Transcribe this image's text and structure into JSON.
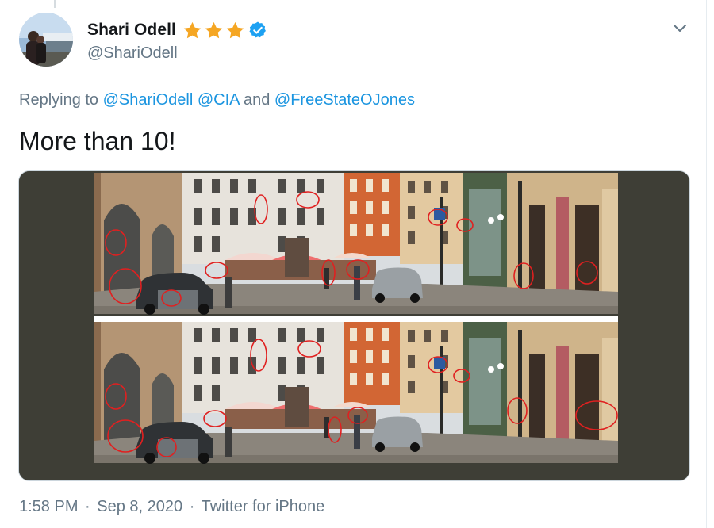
{
  "tweet": {
    "author": {
      "display_name": "Shari Odell",
      "handle": "@ShariOdell",
      "badges": [
        "star-icon",
        "star-icon",
        "star-icon",
        "verified-badge-icon"
      ]
    },
    "reply": {
      "prefix": "Replying to",
      "mentions": [
        "@ShariOdell",
        "@CIA",
        "@FreeStateOJones"
      ],
      "separator_1": " ",
      "separator_2": " and "
    },
    "text": "More than 10!",
    "meta": {
      "time": "1:58 PM",
      "dot": "·",
      "date": "Sep 8, 2020",
      "source": "Twitter for iPhone"
    },
    "menu_icon": "chevron-down-icon"
  },
  "colors": {
    "link": "#1b95e0",
    "secondary": "#657786",
    "star": "#f5a623",
    "verified": "#1da1f2",
    "media_bg": "#3e3e36"
  }
}
